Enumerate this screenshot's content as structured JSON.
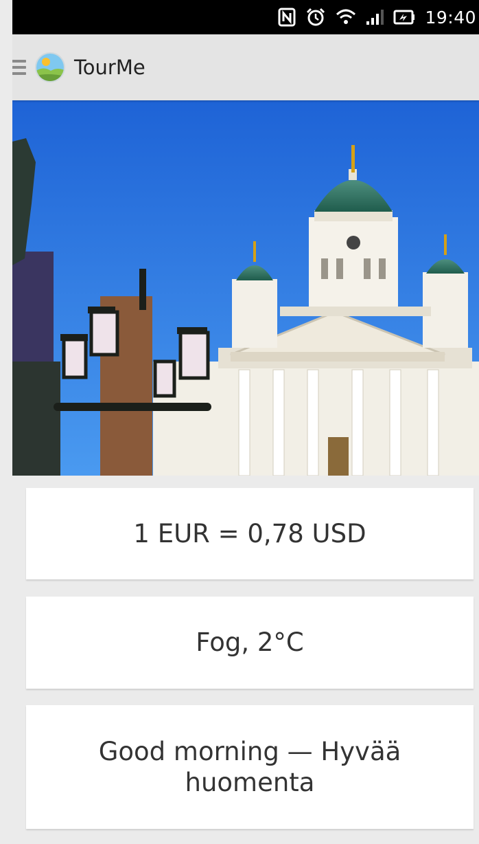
{
  "status_bar": {
    "icons": [
      "nfc-icon",
      "alarm-icon",
      "wifi-icon",
      "signal-icon",
      "battery-icon"
    ],
    "time": "19:40"
  },
  "action_bar": {
    "menu_icon": "hamburger-icon",
    "logo_icon": "tourme-logo-icon",
    "title": "TourMe"
  },
  "hero": {
    "icon": "helsinki-cathedral-photo"
  },
  "cards": {
    "exchange_rate": "1 EUR = 0,78 USD",
    "weather": "Fog, 2°C",
    "greeting": "Good morning — Hyvää huomenta"
  },
  "colors": {
    "status_bar": "#000000",
    "action_bar": "#e4e4e4",
    "background": "#ebebeb",
    "card": "#ffffff",
    "text": "#333333"
  }
}
